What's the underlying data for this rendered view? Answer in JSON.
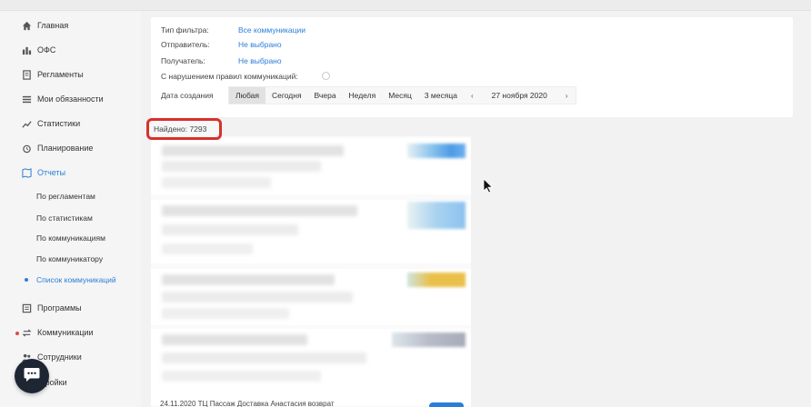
{
  "sidebar": {
    "items": [
      {
        "label": "Главная",
        "icon": "home-icon"
      },
      {
        "label": "ОФС",
        "icon": "org-chart-icon"
      },
      {
        "label": "Регламенты",
        "icon": "document-icon"
      },
      {
        "label": "Мои обязанности",
        "icon": "list-icon"
      },
      {
        "label": "Статистики",
        "icon": "trend-icon"
      },
      {
        "label": "Планирование",
        "icon": "alarm-clock-icon"
      },
      {
        "label": "Отчеты",
        "icon": "report-icon"
      },
      {
        "label": "Программы",
        "icon": "program-icon"
      },
      {
        "label": "Коммуникации",
        "icon": "arrows-icon"
      },
      {
        "label": "Сотрудники",
        "icon": "people-icon"
      },
      {
        "label": "Настройки",
        "icon": "gear-icon"
      }
    ],
    "sub_items": [
      {
        "label": "По регламентам"
      },
      {
        "label": "По статистикам"
      },
      {
        "label": "По коммуникациям"
      },
      {
        "label": "По коммуникатору"
      },
      {
        "label": "Список коммуникаций"
      }
    ],
    "visible_settings_label": "стройки"
  },
  "filter": {
    "type_label": "Тип фильтра:",
    "type_value": "Все коммуникации",
    "sender_label": "Отправитель:",
    "sender_value": "Не выбрано",
    "recipient_label": "Получатель:",
    "recipient_value": "Не выбрано",
    "violation_label": "С нарушением правил коммуникаций:",
    "date_label": "Дата создания",
    "periods": [
      "Любая",
      "Сегодня",
      "Вчера",
      "Неделя",
      "Месяц",
      "3 месяца"
    ],
    "selected_period": "Любая",
    "date_value": "27 ноября 2020",
    "prev_arrow": "‹",
    "next_arrow": "›"
  },
  "found": {
    "label": "Найдено: 7293"
  },
  "bottom_line": "24.11.2020 ТЦ Пассаж Доставка Анастасия возврат",
  "colors": {
    "accent": "#2b7ed8",
    "highlight_box": "#d9302b",
    "chat_button": "#1e2533",
    "yellow_tag": "#e8c04a"
  }
}
